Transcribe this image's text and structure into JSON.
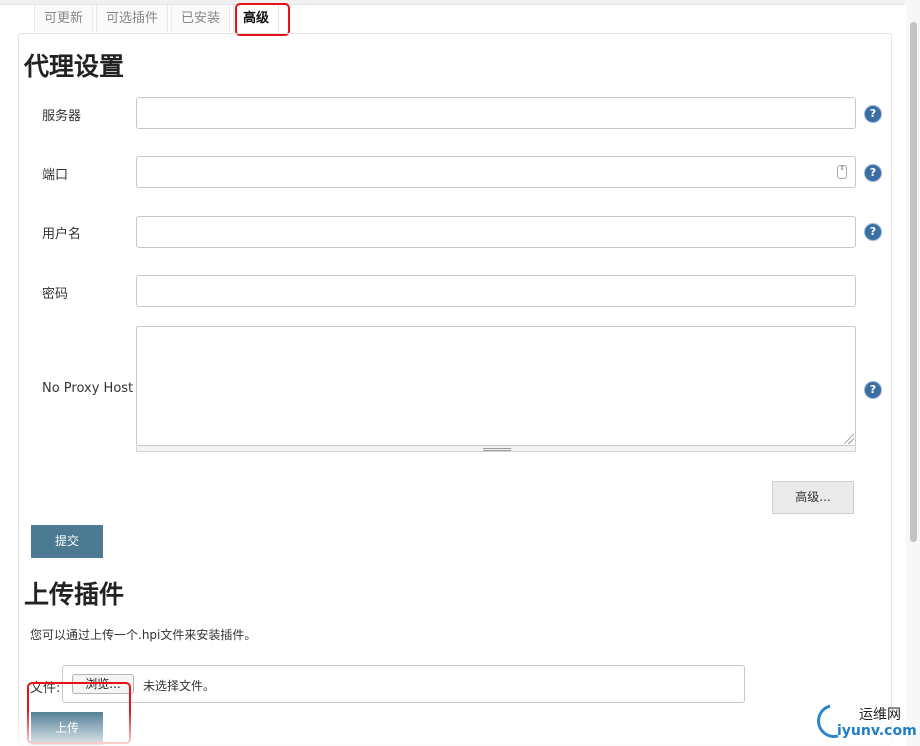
{
  "tabs": [
    {
      "label": "可更新"
    },
    {
      "label": "可选插件"
    },
    {
      "label": "已安装"
    },
    {
      "label": "高级"
    }
  ],
  "proxy": {
    "title": "代理设置",
    "fields": {
      "server_label": "服务器",
      "port_label": "端口",
      "username_label": "用户名",
      "password_label": "密码",
      "no_proxy_label": "No Proxy Host"
    },
    "help_glyph": "?",
    "spinner_glyph": "⇕",
    "advanced_button": "高级...",
    "submit_button": "提交"
  },
  "upload": {
    "title": "上传插件",
    "description": "您可以通过上传一个.hpi文件来安装插件。",
    "file_label": "文件:",
    "browse_button": "浏览...",
    "no_file_text": "未选择文件。",
    "upload_button": "上传"
  },
  "watermark": {
    "cn": "运维网",
    "en": "iyunv.com"
  },
  "colors": {
    "accent_button": "#4b7a92",
    "highlight": "#e8101a",
    "help_icon": "#3a6ea5"
  }
}
